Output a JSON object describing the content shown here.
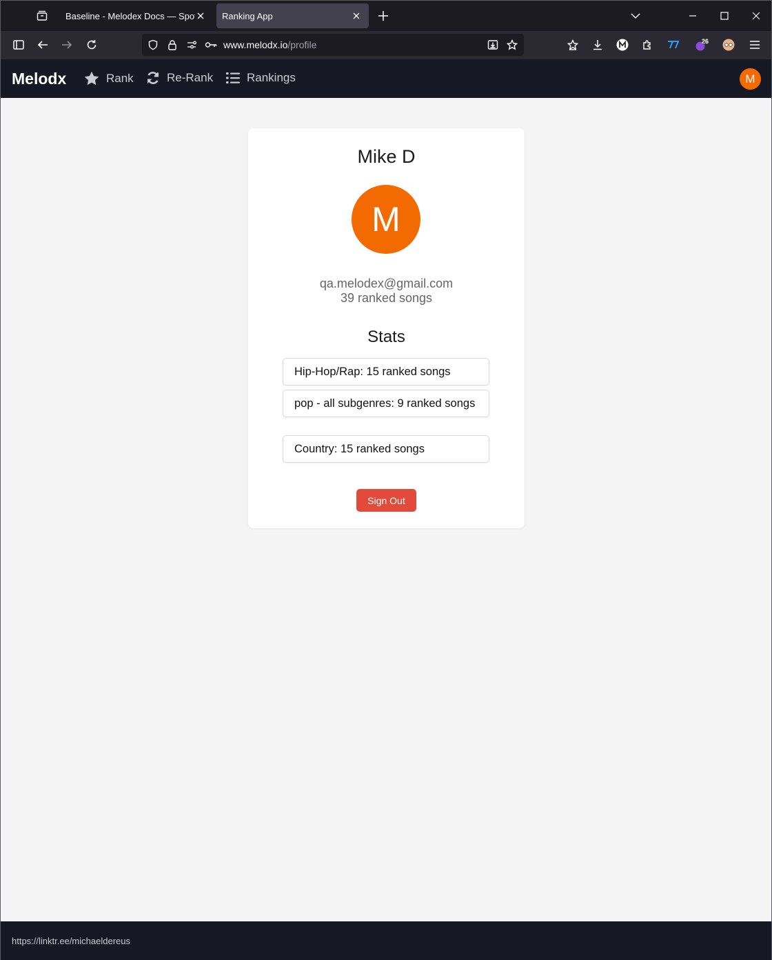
{
  "browser": {
    "tabs": [
      {
        "title": "Baseline - Melodex Docs — Spotify"
      },
      {
        "title": "Ranking App"
      }
    ],
    "url": {
      "host": "www.melodx.io",
      "path": "/profile"
    },
    "extension_badge": "26"
  },
  "nav": {
    "brand": "Melodx",
    "links": [
      {
        "label": "Rank",
        "icon": "star-icon"
      },
      {
        "label": "Re-Rank",
        "icon": "refresh-icon"
      },
      {
        "label": "Rankings",
        "icon": "list-icon"
      }
    ],
    "avatar_initial": "M"
  },
  "profile": {
    "name": "Mike D",
    "avatar_initial": "M",
    "email": "qa.melodex@gmail.com",
    "ranked_count": "39 ranked songs",
    "stats_heading": "Stats",
    "stats": [
      {
        "text": "Hip-Hop/Rap: 15 ranked songs"
      },
      {
        "text": "pop - all subgenres: 9 ranked songs"
      },
      {
        "text": "Country: 15 ranked songs"
      }
    ],
    "sign_out_label": "Sign Out"
  },
  "status_link": "https://linktr.ee/michaeldereus",
  "colors": {
    "accent": "#f36b00",
    "danger": "#e24b3b",
    "navbar": "#161923"
  }
}
